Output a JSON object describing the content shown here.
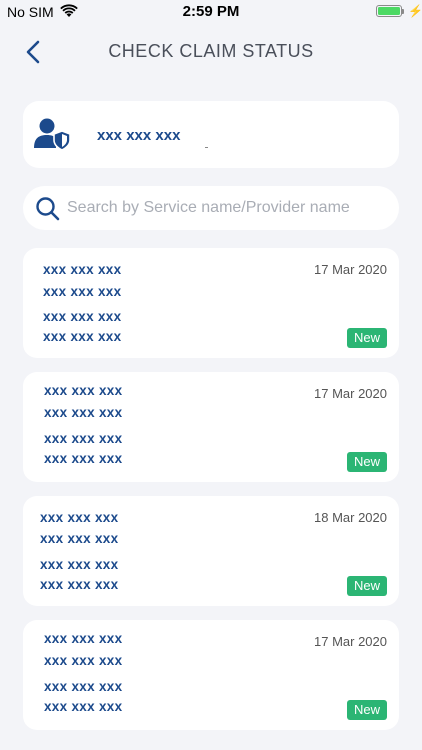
{
  "status_bar": {
    "carrier": "No SIM",
    "time": "2:59 PM"
  },
  "header": {
    "title": "CHECK CLAIM STATUS"
  },
  "profile": {
    "name": "xxx xxx xxx",
    "icon": "user-shield-icon"
  },
  "search": {
    "placeholder": "Search by Service name/Provider name"
  },
  "claims": [
    {
      "line1": "xxx xxx xxx",
      "line2": "xxx xxx xxx",
      "line3": "xxx xxx xxx",
      "line4": "xxx xxx xxx",
      "date": "17 Mar 2020",
      "status": "New"
    },
    {
      "line1": "xxx xxx xxx",
      "line2": "xxx xxx xxx",
      "line3": "xxx xxx xxx",
      "line4": "xxx xxx xxx",
      "date": "17 Mar 2020",
      "status": "New"
    },
    {
      "line1": "xxx xxx xxx",
      "line2": "xxx xxx xxx",
      "line3": "xxx xxx xxx",
      "line4": "xxx xxx xxx",
      "date": "18 Mar 2020",
      "status": "New"
    },
    {
      "line1": "xxx xxx xxx",
      "line2": "xxx xxx xxx",
      "line3": "xxx xxx xxx",
      "line4": "xxx xxx xxx",
      "date": "17 Mar 2020",
      "status": "New"
    }
  ],
  "colors": {
    "primary": "#1c4a8c",
    "badge": "#2bb574",
    "background": "#f3f4f8"
  }
}
